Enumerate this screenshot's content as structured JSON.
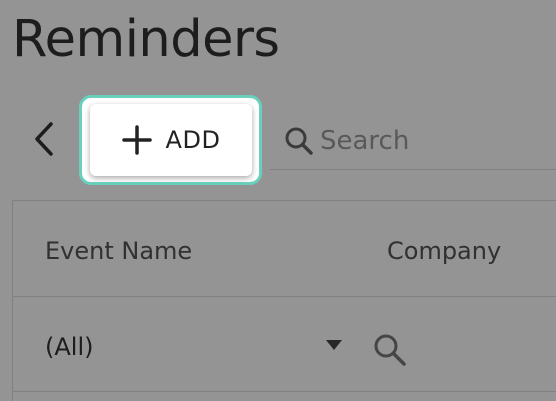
{
  "page": {
    "title": "Reminders"
  },
  "toolbar": {
    "back_icon": "chevron-left-icon",
    "add_label": "ADD",
    "add_icon": "plus-icon",
    "search_placeholder": "Search",
    "search_icon": "search-icon"
  },
  "grid": {
    "columns": [
      {
        "label": "Event Name"
      },
      {
        "label": "Company"
      }
    ],
    "filter": {
      "event_name_value": "(All)",
      "dropdown_icon": "caret-down-icon",
      "search_icon": "search-icon"
    }
  },
  "colors": {
    "highlight": "#6ad0bd",
    "overlay": "rgba(0,0,0,0.42)"
  }
}
